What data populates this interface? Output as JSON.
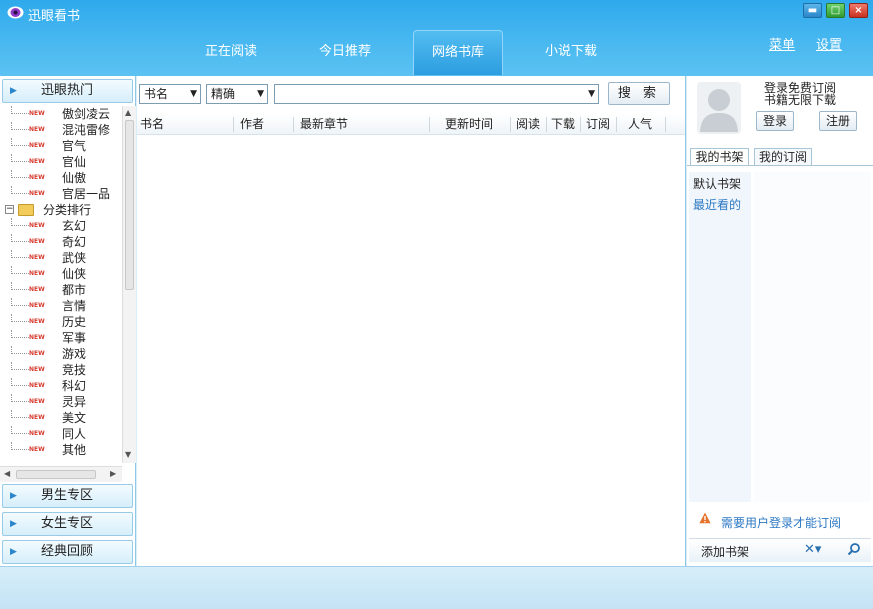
{
  "app": {
    "title": "迅眼看书"
  },
  "window_controls": {
    "minimize": "▬",
    "maximize": "□",
    "close": "×"
  },
  "nav": {
    "tabs": [
      {
        "label": "正在阅读"
      },
      {
        "label": "今日推荐"
      },
      {
        "label": "网络书库"
      },
      {
        "label": "小说下载"
      }
    ],
    "active_tab": "网络书库",
    "menu_link": "菜单",
    "settings_link": "设置"
  },
  "left_panel": {
    "hot_header": "迅眼热门",
    "hot_items": [
      "傲剑凌云",
      "混沌雷修",
      "官气",
      "官仙",
      "仙傲",
      "官居一品"
    ],
    "new_tag": "NEW",
    "category_group": "分类排行",
    "category_items": [
      "玄幻",
      "奇幻",
      "武侠",
      "仙侠",
      "都市",
      "言情",
      "历史",
      "军事",
      "游戏",
      "竞技",
      "科幻",
      "灵异",
      "美文",
      "同人",
      "其他"
    ],
    "male_header": "男生专区",
    "female_header": "女生专区",
    "classic_header": "经典回顾"
  },
  "search": {
    "field_select": "书名",
    "match_select": "精确",
    "input_value": "",
    "button_label": "搜 索"
  },
  "table": {
    "columns": [
      "书名",
      "作者",
      "最新章节",
      "更新时间",
      "阅读",
      "下载",
      "订阅",
      "人气"
    ],
    "rows": []
  },
  "right_panel": {
    "promo_line1": "登录免费订阅",
    "promo_line2": "书籍无限下载",
    "login_button": "登录",
    "register_button": "注册",
    "tab_bookshelf": "我的书架",
    "tab_subscribe": "我的订阅",
    "shelf_default": "默认书架",
    "shelf_recent": "最近看的",
    "login_notice": "需要用户登录才能订阅",
    "add_shelf": "添加书架",
    "delete_icon_glyph": "✕▾"
  },
  "colors": {
    "titlebar": "#2fa9ec",
    "accent_link": "#2c78c4",
    "panel_border": "#8fc7e6"
  }
}
